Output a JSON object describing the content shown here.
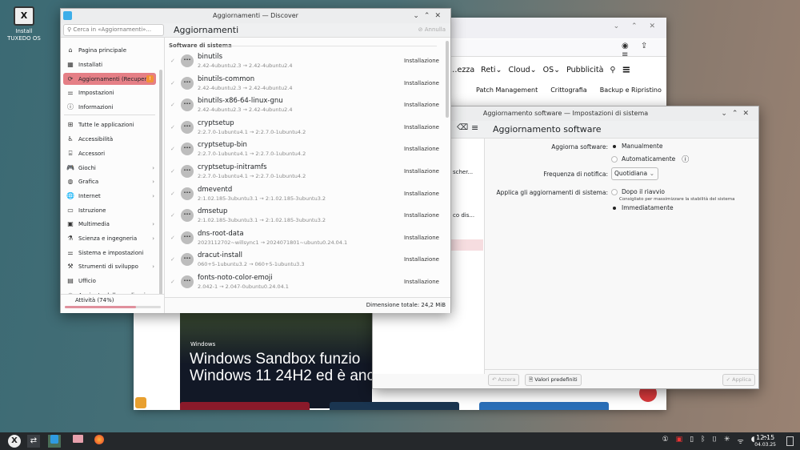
{
  "desktop": {
    "icon_label": "Install TUXEDO OS"
  },
  "browser": {
    "nav": [
      "…ezza",
      "Reti",
      "Cloud",
      "OS",
      "Pubblicità"
    ],
    "subnav": [
      "Patch Management",
      "Crittografia",
      "Backup e Ripristino"
    ],
    "hero_category": "Windows",
    "hero_title_1": "Windows Sandbox funzio",
    "hero_title_2": "Windows 11 24H2 ed è anc"
  },
  "discover": {
    "window_title": "Aggiornamenti — Discover",
    "search_placeholder": "Cerca in «Aggiornamenti»...",
    "page_title": "Aggiornamenti",
    "cancel_label": "Annulla",
    "sidebar": [
      {
        "label": "Pagina principale",
        "icon": "home"
      },
      {
        "label": "Installati",
        "icon": "installed"
      },
      {
        "label": "Aggiornamenti (Recuper...",
        "icon": "updates",
        "active": true,
        "badge": "!"
      },
      {
        "label": "Impostazioni",
        "icon": "settings"
      },
      {
        "label": "Informazioni",
        "icon": "info"
      },
      {
        "label": "Tutte le applicazioni",
        "icon": "grid"
      },
      {
        "label": "Accessibilità",
        "icon": "accessibility"
      },
      {
        "label": "Accessori",
        "icon": "accessories"
      },
      {
        "label": "Giochi",
        "icon": "games",
        "chevron": true
      },
      {
        "label": "Grafica",
        "icon": "graphics",
        "chevron": true
      },
      {
        "label": "Internet",
        "icon": "globe",
        "chevron": true
      },
      {
        "label": "Istruzione",
        "icon": "education"
      },
      {
        "label": "Multimedia",
        "icon": "multimedia",
        "chevron": true
      },
      {
        "label": "Scienza e ingegneria",
        "icon": "science",
        "chevron": true
      },
      {
        "label": "Sistema e impostazioni",
        "icon": "system"
      },
      {
        "label": "Strumenti di sviluppo",
        "icon": "dev",
        "chevron": true
      },
      {
        "label": "Ufficio",
        "icon": "office"
      },
      {
        "label": "Aggiunte delle applicazi...",
        "icon": "addons",
        "chevron": true
      }
    ],
    "activity_label": "Attività (74%)",
    "activity_progress": 74,
    "section": "Software di sistema",
    "updates": [
      {
        "name": "binutils",
        "version": "2.42-4ubuntu2.3 → 2.42-4ubuntu2.4",
        "action": "Installazione"
      },
      {
        "name": "binutils-common",
        "version": "2.42-4ubuntu2.3 → 2.42-4ubuntu2.4",
        "action": "Installazione"
      },
      {
        "name": "binutils-x86-64-linux-gnu",
        "version": "2.42-4ubuntu2.3 → 2.42-4ubuntu2.4",
        "action": "Installazione"
      },
      {
        "name": "cryptsetup",
        "version": "2:2.7.0-1ubuntu4.1 → 2:2.7.0-1ubuntu4.2",
        "action": "Installazione"
      },
      {
        "name": "cryptsetup-bin",
        "version": "2:2.7.0-1ubuntu4.1 → 2:2.7.0-1ubuntu4.2",
        "action": "Installazione"
      },
      {
        "name": "cryptsetup-initramfs",
        "version": "2:2.7.0-1ubuntu4.1 → 2:2.7.0-1ubuntu4.2",
        "action": "Installazione"
      },
      {
        "name": "dmeventd",
        "version": "2:1.02.185-3ubuntu3.1 → 2:1.02.185-3ubuntu3.2",
        "action": "Installazione"
      },
      {
        "name": "dmsetup",
        "version": "2:1.02.185-3ubuntu3.1 → 2:1.02.185-3ubuntu3.2",
        "action": "Installazione"
      },
      {
        "name": "dns-root-data",
        "version": "2023112702~willsync1 → 2024071801~ubuntu0.24.04.1",
        "action": "Installazione"
      },
      {
        "name": "dracut-install",
        "version": "060+5-1ubuntu3.2 → 060+5-1ubuntu3.3",
        "action": "Installazione"
      },
      {
        "name": "fonts-noto-color-emoji",
        "version": "2.042-1 → 2.047-0ubuntu0.24.04.1",
        "action": "Installazione"
      }
    ],
    "total_size": "Dimensione totale: 24,2 MiB"
  },
  "settings": {
    "window_title": "Aggiornamento software — Impostazioni di sistema",
    "page_title": "Aggiornamento software",
    "left_fragments": [
      "scher...",
      "co dis..."
    ],
    "update_label": "Aggiorna software:",
    "update_options": [
      "Manualmente",
      "Automaticamente"
    ],
    "update_selected": 0,
    "notify_label": "Frequenza di notifica:",
    "notify_value": "Quotidiana",
    "apply_label": "Applica gli aggiornamenti di sistema:",
    "apply_options": [
      "Dopo il riavvio",
      "Immediatamente"
    ],
    "apply_hint": "Consigliato per massimizzare la stabilità del sistema",
    "apply_selected": 1,
    "reset_label": "Azzera",
    "defaults_label": "Valori predefiniti",
    "apply_button": "Applica"
  },
  "taskbar": {
    "time": "12:15",
    "date": "04.03.25"
  },
  "colors": {
    "accent": "#e57f86",
    "badge": "#f29235",
    "taskbar": "#25282b"
  }
}
